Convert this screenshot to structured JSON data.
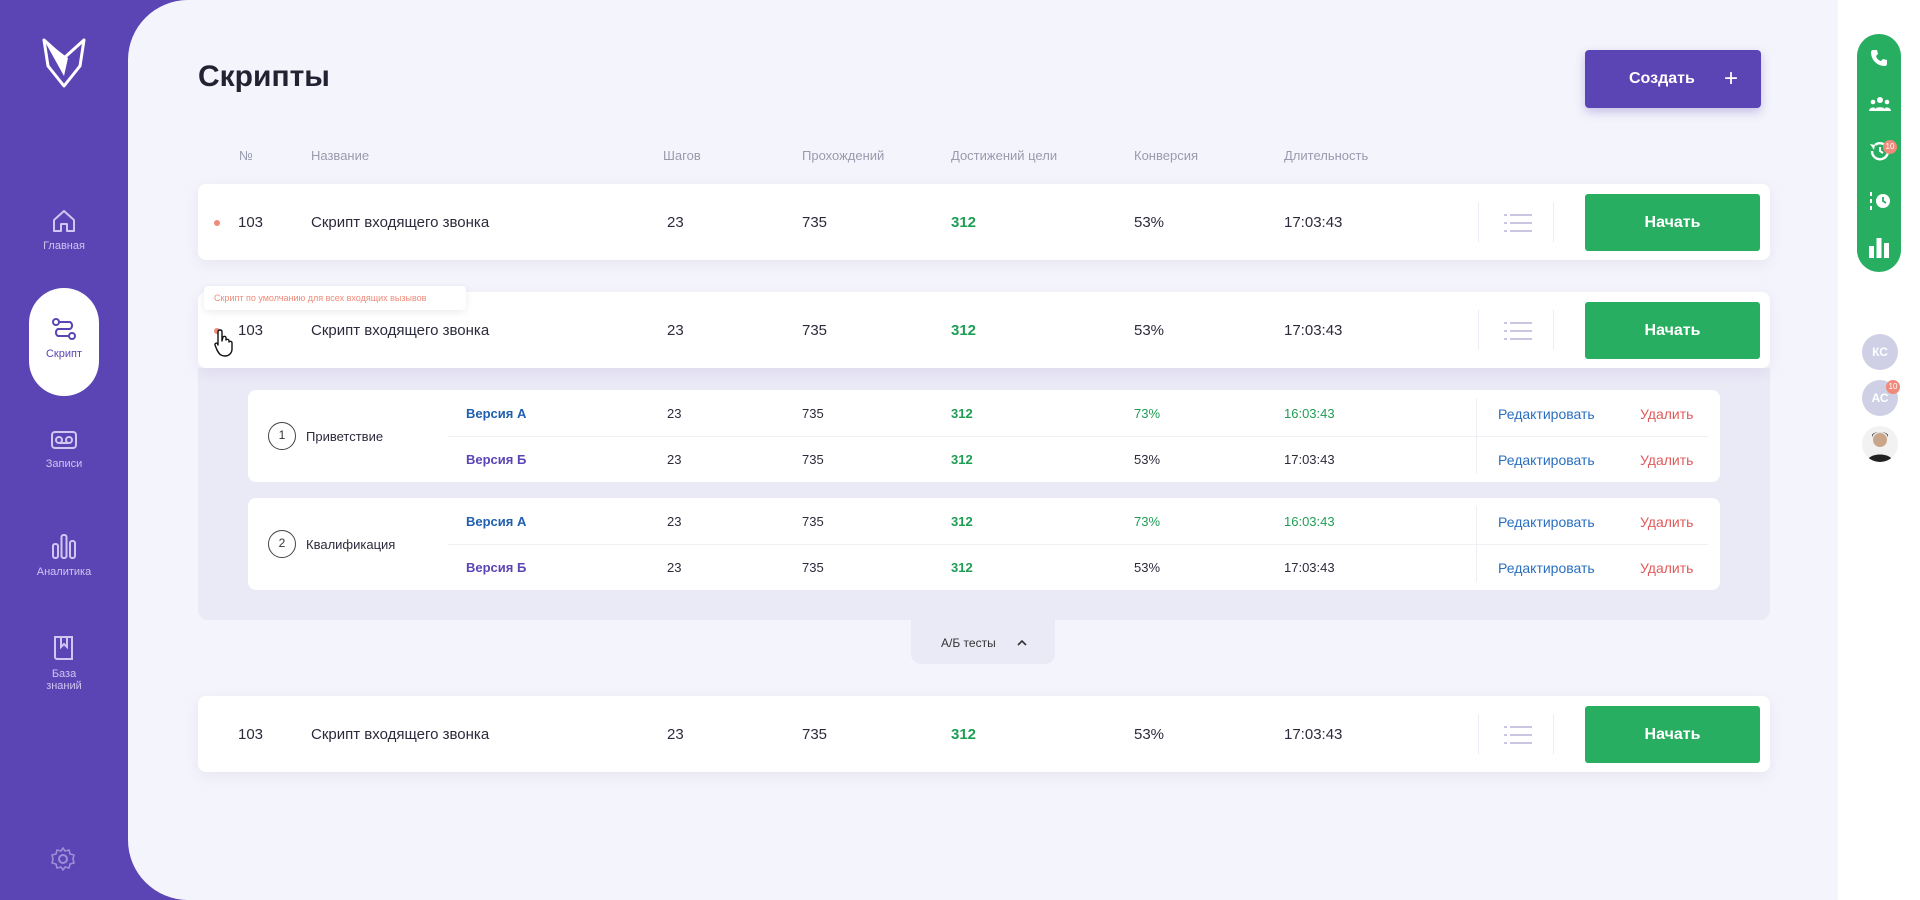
{
  "sidebar": {
    "items": [
      {
        "label": "Главная",
        "icon": "home-icon"
      },
      {
        "label": "Скрипт",
        "icon": "script-icon"
      },
      {
        "label": "Записи",
        "icon": "voicemail-icon"
      },
      {
        "label": "Аналитика",
        "icon": "bar-chart-icon"
      },
      {
        "label": "База\nзнаний",
        "label_line1": "База",
        "label_line2": "знаний",
        "icon": "book-icon"
      }
    ],
    "active": "Скрипт"
  },
  "header": {
    "title": "Скрипты",
    "create_label": "Создать",
    "create_icon": "+"
  },
  "table": {
    "columns": [
      "№",
      "Название",
      "Шагов",
      "Прохождений",
      "Достижений цели",
      "Конверсия",
      "Длительность"
    ],
    "rows": [
      {
        "num": "103",
        "name": "Скрипт входящего звонка",
        "steps": "23",
        "passes": "735",
        "goals": "312",
        "conversion": "53%",
        "duration": "17:03:43",
        "action": "Начать"
      },
      {
        "num": "103",
        "name": "Скрипт входящего звонка",
        "steps": "23",
        "passes": "735",
        "goals": "312",
        "conversion": "53%",
        "duration": "17:03:43",
        "action": "Начать"
      },
      {
        "num": "103",
        "name": "Скрипт входящего звонка",
        "steps": "23",
        "passes": "735",
        "goals": "312",
        "conversion": "53%",
        "duration": "17:03:43",
        "action": "Начать"
      }
    ]
  },
  "tooltip": "Скрипт по умолчанию для всех входящих вызывов",
  "ab": {
    "toggle_label": "А/Б тесты",
    "steps": [
      {
        "num": "1",
        "name": "Приветствие",
        "versions": [
          {
            "label": "Версия А",
            "steps": "23",
            "passes": "735",
            "goals": "312",
            "conversion": "73%",
            "duration": "16:03:43",
            "edit": "Редактировать",
            "delete": "Удалить"
          },
          {
            "label": "Версия Б",
            "steps": "23",
            "passes": "735",
            "goals": "312",
            "conversion": "53%",
            "duration": "17:03:43",
            "edit": "Редактировать",
            "delete": "Удалить"
          }
        ]
      },
      {
        "num": "2",
        "name": "Квалификация",
        "versions": [
          {
            "label": "Версия А",
            "steps": "23",
            "passes": "735",
            "goals": "312",
            "conversion": "73%",
            "duration": "16:03:43",
            "edit": "Редактировать",
            "delete": "Удалить"
          },
          {
            "label": "Версия Б",
            "steps": "23",
            "passes": "735",
            "goals": "312",
            "conversion": "53%",
            "duration": "17:03:43",
            "edit": "Редактировать",
            "delete": "Удалить"
          }
        ]
      }
    ]
  },
  "right_bar": {
    "badge1": "10",
    "badge2": "10",
    "avatars": [
      "КС",
      "АС"
    ]
  },
  "colors": {
    "brand": "#5b44b4",
    "green": "#27ae60",
    "accent_red": "#f08a7a"
  }
}
